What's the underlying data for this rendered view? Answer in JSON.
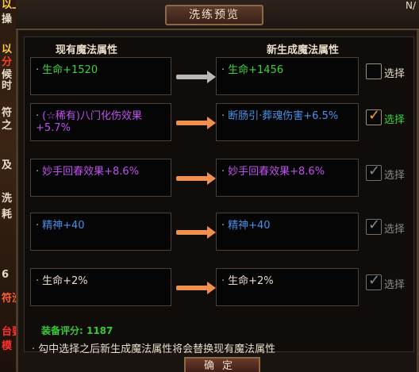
{
  "window": {
    "title": "洗练预览"
  },
  "side_text": [
    "以上",
    "操",
    "以",
    "分",
    "候",
    "时",
    "符",
    "之",
    "及",
    "洗",
    "耗",
    "6",
    "符洗",
    "台要",
    "模"
  ],
  "top_right_text": "N/",
  "columns": {
    "current": "现有魔法属性",
    "new": "新生成魔法属性"
  },
  "colors": {
    "green": "#3cd23c",
    "purple": "#c050f0",
    "blue": "#4a90e8",
    "orange_arrow": "#f09050"
  },
  "rows": [
    {
      "current": "生命+1520",
      "current_color": "#3cd23c",
      "new": "生命+1456",
      "new_color": "#3cd23c",
      "arrow": "grey",
      "checkbox": "unchecked",
      "select_label": "选择"
    },
    {
      "current": "(☆稀有)八门化伤效果+5.7%",
      "current_color": "#c050f0",
      "new": "断肠引·葬魂伤害+6.5%",
      "new_color": "#4a90e8",
      "arrow": "orange",
      "checkbox": "checked",
      "select_label": "选择"
    },
    {
      "current": "妙手回春效果+8.6%",
      "current_color": "#c050f0",
      "new": "妙手回春效果+8.6%",
      "new_color": "#c050f0",
      "arrow": "orange",
      "checkbox": "disabled",
      "select_label": "选择"
    },
    {
      "current": "精神+40",
      "current_color": "#4a90e8",
      "new": "精神+40",
      "new_color": "#4a90e8",
      "arrow": "orange",
      "checkbox": "disabled",
      "select_label": "选择"
    },
    {
      "current": "生命+2%",
      "current_color": "#e8dcc8",
      "new": "生命+2%",
      "new_color": "#e8dcc8",
      "arrow": "orange",
      "checkbox": "disabled",
      "select_label": "选择"
    }
  ],
  "footer": {
    "score_label": "装备评分: 1187",
    "note": "勾中选择之后新生成魔法属性将会替换现有魔法属性"
  },
  "confirm_label": "确定"
}
